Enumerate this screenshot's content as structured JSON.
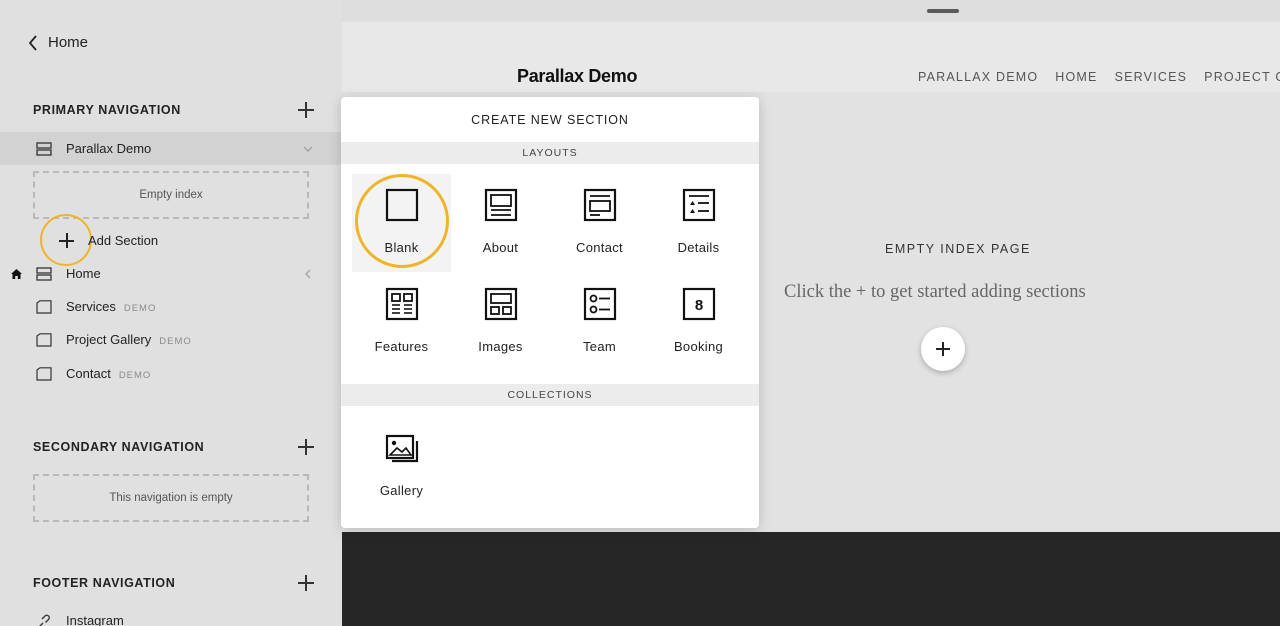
{
  "sidebar": {
    "back_label": "Home",
    "primary": {
      "title": "PRIMARY NAVIGATION",
      "items": [
        {
          "label": "Parallax Demo",
          "badge": "",
          "icon": "index-icon",
          "selected": true
        },
        {
          "label": "Home",
          "badge": "",
          "icon": "index-icon",
          "is_homepage": true
        },
        {
          "label": "Services",
          "badge": "DEMO",
          "icon": "page-icon"
        },
        {
          "label": "Project Gallery",
          "badge": "DEMO",
          "icon": "page-icon"
        },
        {
          "label": "Contact",
          "badge": "DEMO",
          "icon": "page-icon"
        }
      ],
      "empty_index_text": "Empty index",
      "add_section_label": "Add Section"
    },
    "secondary": {
      "title": "SECONDARY NAVIGATION",
      "empty_text": "This navigation is empty"
    },
    "footer": {
      "title": "FOOTER NAVIGATION",
      "items": [
        {
          "label": "Instagram",
          "icon": "link-icon"
        }
      ]
    }
  },
  "preview": {
    "site_title": "Parallax Demo",
    "nav": [
      "PARALLAX DEMO",
      "HOME",
      "SERVICES",
      "PROJECT GALLERY"
    ],
    "empty_title": "EMPTY INDEX PAGE",
    "empty_subtitle": "Click the + to get started adding sections"
  },
  "modal": {
    "title": "CREATE NEW SECTION",
    "layouts_label": "LAYOUTS",
    "layouts": [
      {
        "label": "Blank",
        "icon": "blank-icon"
      },
      {
        "label": "About",
        "icon": "about-icon"
      },
      {
        "label": "Contact",
        "icon": "contact-icon"
      },
      {
        "label": "Details",
        "icon": "details-icon"
      },
      {
        "label": "Features",
        "icon": "features-icon"
      },
      {
        "label": "Images",
        "icon": "images-icon"
      },
      {
        "label": "Team",
        "icon": "team-icon"
      },
      {
        "label": "Booking",
        "icon": "booking-icon",
        "glyph": "8"
      }
    ],
    "collections_label": "COLLECTIONS",
    "collections": [
      {
        "label": "Gallery",
        "icon": "gallery-icon"
      }
    ]
  },
  "colors": {
    "highlight": "#f0b429",
    "sidebar_bg": "#e0e0e0",
    "dark_band": "#262626"
  }
}
